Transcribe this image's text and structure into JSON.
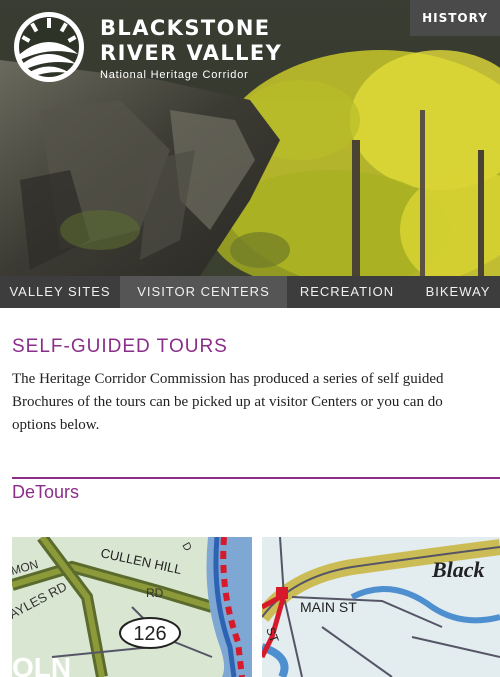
{
  "header": {
    "brand_line1": "BLACKSTONE",
    "brand_line2": "RIVER VALLEY",
    "brand_line3": "National Heritage Corridor",
    "history_button": "HISTORY"
  },
  "nav": {
    "items": [
      {
        "label": "VALLEY SITES"
      },
      {
        "label": "VISITOR CENTERS"
      },
      {
        "label": "RECREATION"
      },
      {
        "label": "BIKEWAY"
      }
    ]
  },
  "main": {
    "page_title": "SELF-GUIDED TOURS",
    "intro_lines": [
      "The Heritage Corridor Commission has produced a series of self guided",
      "Brochures of the tours can be picked up at visitor Centers or you can do",
      "options below."
    ],
    "section_title": "DeTours",
    "maps": [
      {
        "labels": [
          "CULLEN HILL",
          "MON",
          "AYLES RD",
          "RD",
          "D",
          "126",
          "OLN"
        ]
      },
      {
        "labels": [
          "MAIN ST",
          "Black",
          "ST"
        ]
      }
    ]
  },
  "colors": {
    "accent": "#8b2e8a",
    "nav_bg": "#3d3d3d",
    "nav_active": "#555555",
    "history_bg": "#4a4a4a"
  }
}
